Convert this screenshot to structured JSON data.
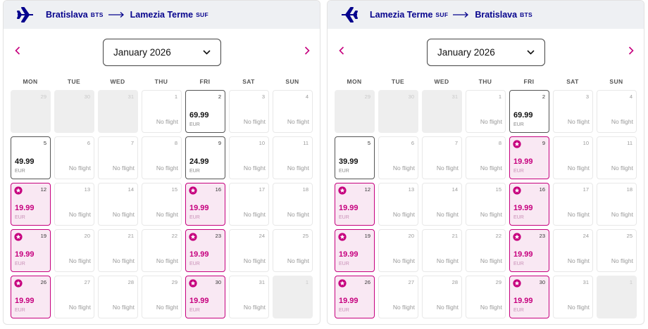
{
  "panels": [
    {
      "origin": {
        "city": "Bratislava",
        "code": "BTS"
      },
      "destination": {
        "city": "Lamezia Terme",
        "code": "SUF"
      },
      "month": "January 2026",
      "weeks": [
        [
          {
            "day": "29",
            "status": "out"
          },
          {
            "day": "30",
            "status": "out"
          },
          {
            "day": "31",
            "status": "out"
          },
          {
            "day": "1",
            "status": "none",
            "text": "No flight"
          },
          {
            "day": "2",
            "status": "avail",
            "price": "69.99",
            "currency": "EUR"
          },
          {
            "day": "3",
            "status": "none",
            "text": "No flight"
          },
          {
            "day": "4",
            "status": "none",
            "text": "No flight"
          }
        ],
        [
          {
            "day": "5",
            "status": "avail",
            "price": "49.99",
            "currency": "EUR"
          },
          {
            "day": "6",
            "status": "none",
            "text": "No flight"
          },
          {
            "day": "7",
            "status": "none",
            "text": "No flight"
          },
          {
            "day": "8",
            "status": "none",
            "text": "No flight"
          },
          {
            "day": "9",
            "status": "avail",
            "price": "24.99",
            "currency": "EUR"
          },
          {
            "day": "10",
            "status": "none",
            "text": "No flight"
          },
          {
            "day": "11",
            "status": "none",
            "text": "No flight"
          }
        ],
        [
          {
            "day": "12",
            "status": "promo",
            "price": "19.99",
            "currency": "EUR"
          },
          {
            "day": "13",
            "status": "none",
            "text": "No flight"
          },
          {
            "day": "14",
            "status": "none",
            "text": "No flight"
          },
          {
            "day": "15",
            "status": "none",
            "text": "No flight"
          },
          {
            "day": "16",
            "status": "promo",
            "price": "19.99",
            "currency": "EUR"
          },
          {
            "day": "17",
            "status": "none",
            "text": "No flight"
          },
          {
            "day": "18",
            "status": "none",
            "text": "No flight"
          }
        ],
        [
          {
            "day": "19",
            "status": "promo",
            "price": "19.99",
            "currency": "EUR"
          },
          {
            "day": "20",
            "status": "none",
            "text": "No flight"
          },
          {
            "day": "21",
            "status": "none",
            "text": "No flight"
          },
          {
            "day": "22",
            "status": "none",
            "text": "No flight"
          },
          {
            "day": "23",
            "status": "promo",
            "price": "19.99",
            "currency": "EUR"
          },
          {
            "day": "24",
            "status": "none",
            "text": "No flight"
          },
          {
            "day": "25",
            "status": "none",
            "text": "No flight"
          }
        ],
        [
          {
            "day": "26",
            "status": "promo",
            "price": "19.99",
            "currency": "EUR"
          },
          {
            "day": "27",
            "status": "none",
            "text": "No flight"
          },
          {
            "day": "28",
            "status": "none",
            "text": "No flight"
          },
          {
            "day": "29",
            "status": "none",
            "text": "No flight"
          },
          {
            "day": "30",
            "status": "promo",
            "price": "19.99",
            "currency": "EUR"
          },
          {
            "day": "31",
            "status": "none",
            "text": "No flight"
          },
          {
            "day": "1",
            "status": "out"
          }
        ]
      ]
    },
    {
      "origin": {
        "city": "Lamezia Terme",
        "code": "SUF"
      },
      "destination": {
        "city": "Bratislava",
        "code": "BTS"
      },
      "month": "January 2026",
      "weeks": [
        [
          {
            "day": "29",
            "status": "out"
          },
          {
            "day": "30",
            "status": "out"
          },
          {
            "day": "31",
            "status": "out"
          },
          {
            "day": "1",
            "status": "none",
            "text": "No flight"
          },
          {
            "day": "2",
            "status": "avail",
            "price": "69.99",
            "currency": "EUR"
          },
          {
            "day": "3",
            "status": "none",
            "text": "No flight"
          },
          {
            "day": "4",
            "status": "none",
            "text": "No flight"
          }
        ],
        [
          {
            "day": "5",
            "status": "avail",
            "price": "39.99",
            "currency": "EUR"
          },
          {
            "day": "6",
            "status": "none",
            "text": "No flight"
          },
          {
            "day": "7",
            "status": "none",
            "text": "No flight"
          },
          {
            "day": "8",
            "status": "none",
            "text": "No flight"
          },
          {
            "day": "9",
            "status": "promo",
            "price": "19.99",
            "currency": "EUR"
          },
          {
            "day": "10",
            "status": "none",
            "text": "No flight"
          },
          {
            "day": "11",
            "status": "none",
            "text": "No flight"
          }
        ],
        [
          {
            "day": "12",
            "status": "promo",
            "price": "19.99",
            "currency": "EUR"
          },
          {
            "day": "13",
            "status": "none",
            "text": "No flight"
          },
          {
            "day": "14",
            "status": "none",
            "text": "No flight"
          },
          {
            "day": "15",
            "status": "none",
            "text": "No flight"
          },
          {
            "day": "16",
            "status": "promo",
            "price": "19.99",
            "currency": "EUR"
          },
          {
            "day": "17",
            "status": "none",
            "text": "No flight"
          },
          {
            "day": "18",
            "status": "none",
            "text": "No flight"
          }
        ],
        [
          {
            "day": "19",
            "status": "promo",
            "price": "19.99",
            "currency": "EUR"
          },
          {
            "day": "20",
            "status": "none",
            "text": "No flight"
          },
          {
            "day": "21",
            "status": "none",
            "text": "No flight"
          },
          {
            "day": "22",
            "status": "none",
            "text": "No flight"
          },
          {
            "day": "23",
            "status": "promo",
            "price": "19.99",
            "currency": "EUR"
          },
          {
            "day": "24",
            "status": "none",
            "text": "No flight"
          },
          {
            "day": "25",
            "status": "none",
            "text": "No flight"
          }
        ],
        [
          {
            "day": "26",
            "status": "promo",
            "price": "19.99",
            "currency": "EUR"
          },
          {
            "day": "27",
            "status": "none",
            "text": "No flight"
          },
          {
            "day": "28",
            "status": "none",
            "text": "No flight"
          },
          {
            "day": "29",
            "status": "none",
            "text": "No flight"
          },
          {
            "day": "30",
            "status": "promo",
            "price": "19.99",
            "currency": "EUR"
          },
          {
            "day": "31",
            "status": "none",
            "text": "No flight"
          },
          {
            "day": "1",
            "status": "out"
          }
        ]
      ]
    }
  ],
  "weekdays": [
    "MON",
    "TUE",
    "WED",
    "THU",
    "FRI",
    "SAT",
    "SUN"
  ],
  "icons": {
    "plane": "plane-icon",
    "arrow": "arrow-right-icon",
    "prev": "chevron-left-icon",
    "next": "chevron-right-icon",
    "dropdown": "chevron-down-icon",
    "promo": "star-badge-icon"
  },
  "colors": {
    "brand_navy": "#06038d",
    "brand_magenta": "#c6007e",
    "promo_bg": "#f9e8f3",
    "header_bg": "#eef0f3",
    "unavailable_bg": "#eeeeee"
  }
}
